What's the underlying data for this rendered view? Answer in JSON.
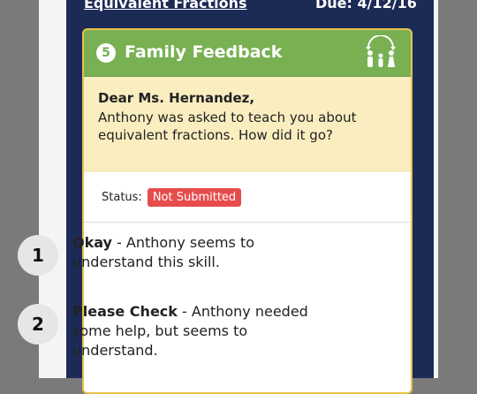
{
  "header": {
    "assignment_title": "Equivalent Fractions",
    "due_label": "Due: 4/12/16"
  },
  "card": {
    "step_number": "5",
    "title": "Family Feedback",
    "icon": "family-icon",
    "greeting": "Dear Ms. Hernandez,",
    "message": "Anthony was asked to teach you about equivalent fractions. How did it go?",
    "status_label": "Status:",
    "status_value": "Not Submitted",
    "status_color": "#e74c4c"
  },
  "options": [
    {
      "number": "1",
      "label": "Okay",
      "text": " - Anthony seems to understand this skill."
    },
    {
      "number": "2",
      "label": "Please Check",
      "text": " - Anthony needed some help, but seems to understand."
    }
  ],
  "colors": {
    "background": "#7a7a7a",
    "screen": "#1c2a56",
    "header_green": "#78b052",
    "message_bg": "#faeec0",
    "card_border": "#e8c24a"
  }
}
